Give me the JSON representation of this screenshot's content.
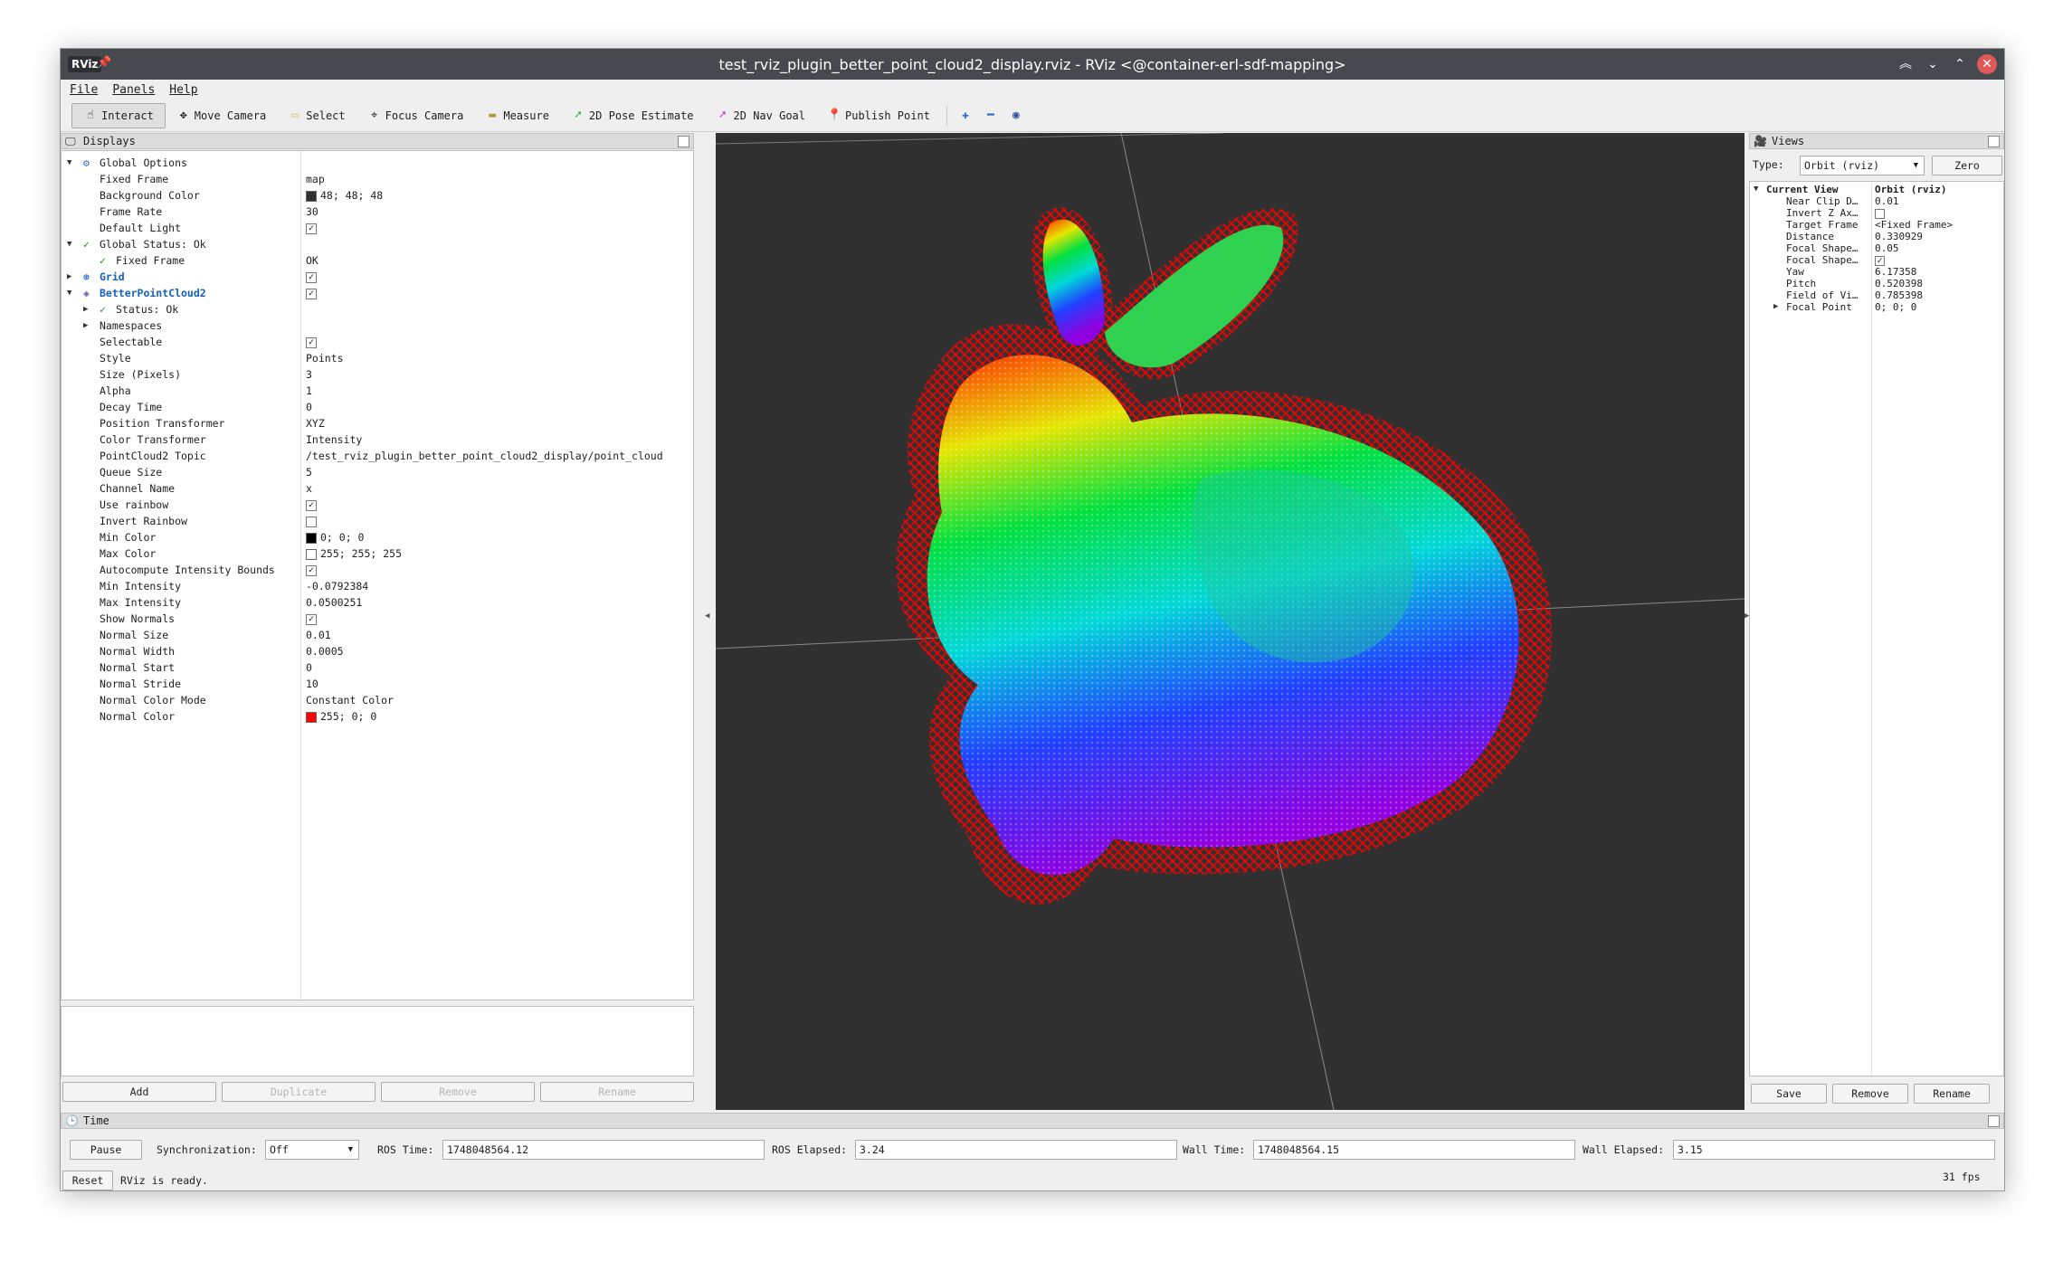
{
  "window": {
    "app_badge": "RViz",
    "title": "test_rviz_plugin_better_point_cloud2_display.rviz - RViz <@container-erl-sdf-mapping>"
  },
  "menu": [
    "File",
    "Panels",
    "Help"
  ],
  "toolbar": {
    "tools": [
      {
        "label": "Interact",
        "icon": "interact-icon"
      },
      {
        "label": "Move Camera",
        "icon": "move-camera-icon"
      },
      {
        "label": "Select",
        "icon": "select-icon"
      },
      {
        "label": "Focus Camera",
        "icon": "focus-camera-icon"
      },
      {
        "label": "Measure",
        "icon": "measure-icon"
      },
      {
        "label": "2D Pose Estimate",
        "icon": "pose-estimate-icon"
      },
      {
        "label": "2D Nav Goal",
        "icon": "nav-goal-icon"
      },
      {
        "label": "Publish Point",
        "icon": "publish-point-icon"
      }
    ]
  },
  "displays": {
    "title": "Displays",
    "rows": [
      {
        "label": "Global Options",
        "value": ""
      },
      {
        "label": "Fixed Frame",
        "value": "map"
      },
      {
        "label": "Background Color",
        "value": "48; 48; 48"
      },
      {
        "label": "Frame Rate",
        "value": "30"
      },
      {
        "label": "Default Light",
        "value": ""
      },
      {
        "label": "Global Status: Ok",
        "value": ""
      },
      {
        "label": "Fixed Frame",
        "value": "OK"
      },
      {
        "label": "Grid",
        "value": ""
      },
      {
        "label": "BetterPointCloud2",
        "value": ""
      },
      {
        "label": "Status: Ok",
        "value": ""
      },
      {
        "label": "Namespaces",
        "value": ""
      },
      {
        "label": "Selectable",
        "value": ""
      },
      {
        "label": "Style",
        "value": "Points"
      },
      {
        "label": "Size (Pixels)",
        "value": "3"
      },
      {
        "label": "Alpha",
        "value": "1"
      },
      {
        "label": "Decay Time",
        "value": "0"
      },
      {
        "label": "Position Transformer",
        "value": "XYZ"
      },
      {
        "label": "Color Transformer",
        "value": "Intensity"
      },
      {
        "label": "PointCloud2 Topic",
        "value": "/test_rviz_plugin_better_point_cloud2_display/point_cloud"
      },
      {
        "label": "Queue Size",
        "value": "5"
      },
      {
        "label": "Channel Name",
        "value": "x"
      },
      {
        "label": "Use rainbow",
        "value": ""
      },
      {
        "label": "Invert Rainbow",
        "value": ""
      },
      {
        "label": "Min Color",
        "value": "0; 0; 0"
      },
      {
        "label": "Max Color",
        "value": "255; 255; 255"
      },
      {
        "label": "Autocompute Intensity Bounds",
        "value": ""
      },
      {
        "label": "Min Intensity",
        "value": "-0.0792384"
      },
      {
        "label": "Max Intensity",
        "value": "0.0500251"
      },
      {
        "label": "Show Normals",
        "value": ""
      },
      {
        "label": "Normal Size",
        "value": "0.01"
      },
      {
        "label": "Normal Width",
        "value": "0.0005"
      },
      {
        "label": "Normal Start",
        "value": "0"
      },
      {
        "label": "Normal Stride",
        "value": "10"
      },
      {
        "label": "Normal Color Mode",
        "value": "Constant Color"
      },
      {
        "label": "Normal Color",
        "value": "255; 0; 0"
      }
    ],
    "buttons": [
      "Add",
      "Duplicate",
      "Remove",
      "Rename"
    ]
  },
  "views": {
    "title": "Views",
    "type_label": "Type:",
    "type_value": "Orbit (rviz)",
    "zero_label": "Zero",
    "rows": [
      {
        "label": "Current View",
        "value": "Orbit (rviz)"
      },
      {
        "label": "Near Clip D…",
        "value": "0.01"
      },
      {
        "label": "Invert Z Ax…",
        "value": ""
      },
      {
        "label": "Target Frame",
        "value": "<Fixed Frame>"
      },
      {
        "label": "Distance",
        "value": "0.330929"
      },
      {
        "label": "Focal Shape…",
        "value": "0.05"
      },
      {
        "label": "Focal Shape…",
        "value": ""
      },
      {
        "label": "Yaw",
        "value": "6.17358"
      },
      {
        "label": "Pitch",
        "value": "0.520398"
      },
      {
        "label": "Field of Vi…",
        "value": "0.785398"
      },
      {
        "label": "Focal Point",
        "value": "0; 0; 0"
      }
    ],
    "buttons": [
      "Save",
      "Remove",
      "Rename"
    ]
  },
  "time": {
    "title": "Time",
    "pause_label": "Pause",
    "sync_label": "Synchronization:",
    "sync_value": "Off",
    "ros_time_label": "ROS Time:",
    "ros_time": "1748048564.12",
    "ros_elapsed_label": "ROS Elapsed:",
    "ros_elapsed": "3.24",
    "wall_time_label": "Wall Time:",
    "wall_time": "1748048564.15",
    "wall_elapsed_label": "Wall Elapsed:",
    "wall_elapsed": "3.15"
  },
  "status": {
    "reset_label": "Reset",
    "message": "RViz is ready.",
    "fps": "31 fps"
  },
  "colors": {
    "viewport_bg": "#303030",
    "normal_color": "#ff0000",
    "titlebar": "#46494d"
  }
}
